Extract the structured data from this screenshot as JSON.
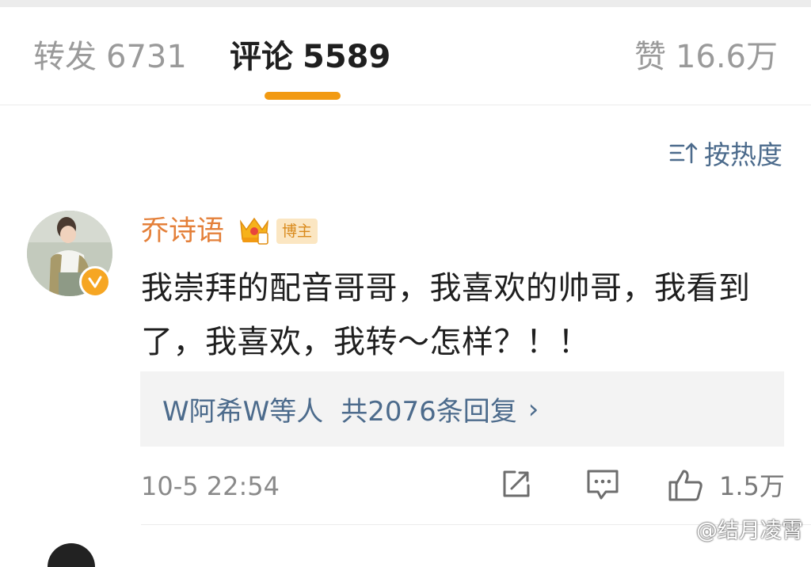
{
  "tabs": {
    "repost": {
      "label": "转发",
      "count": "6731"
    },
    "comments": {
      "label": "评论",
      "count": "5589"
    },
    "likes": {
      "label": "赞",
      "count": "16.6万"
    }
  },
  "sort": {
    "label": "按热度"
  },
  "comment": {
    "username": "乔诗语",
    "badge": "博主",
    "text": "我崇拜的配音哥哥，我喜欢的帅哥，我看到了，我喜欢，我转～怎样？！！",
    "replies": {
      "names": "W阿希W等人",
      "count": "共2076条回复"
    },
    "time": "10-5 22:54",
    "like_count": "1.5万"
  },
  "watermark": "@结月凌霄",
  "colors": {
    "accent": "#f29a12",
    "link": "#4c6b8c",
    "username": "#e4803a"
  }
}
